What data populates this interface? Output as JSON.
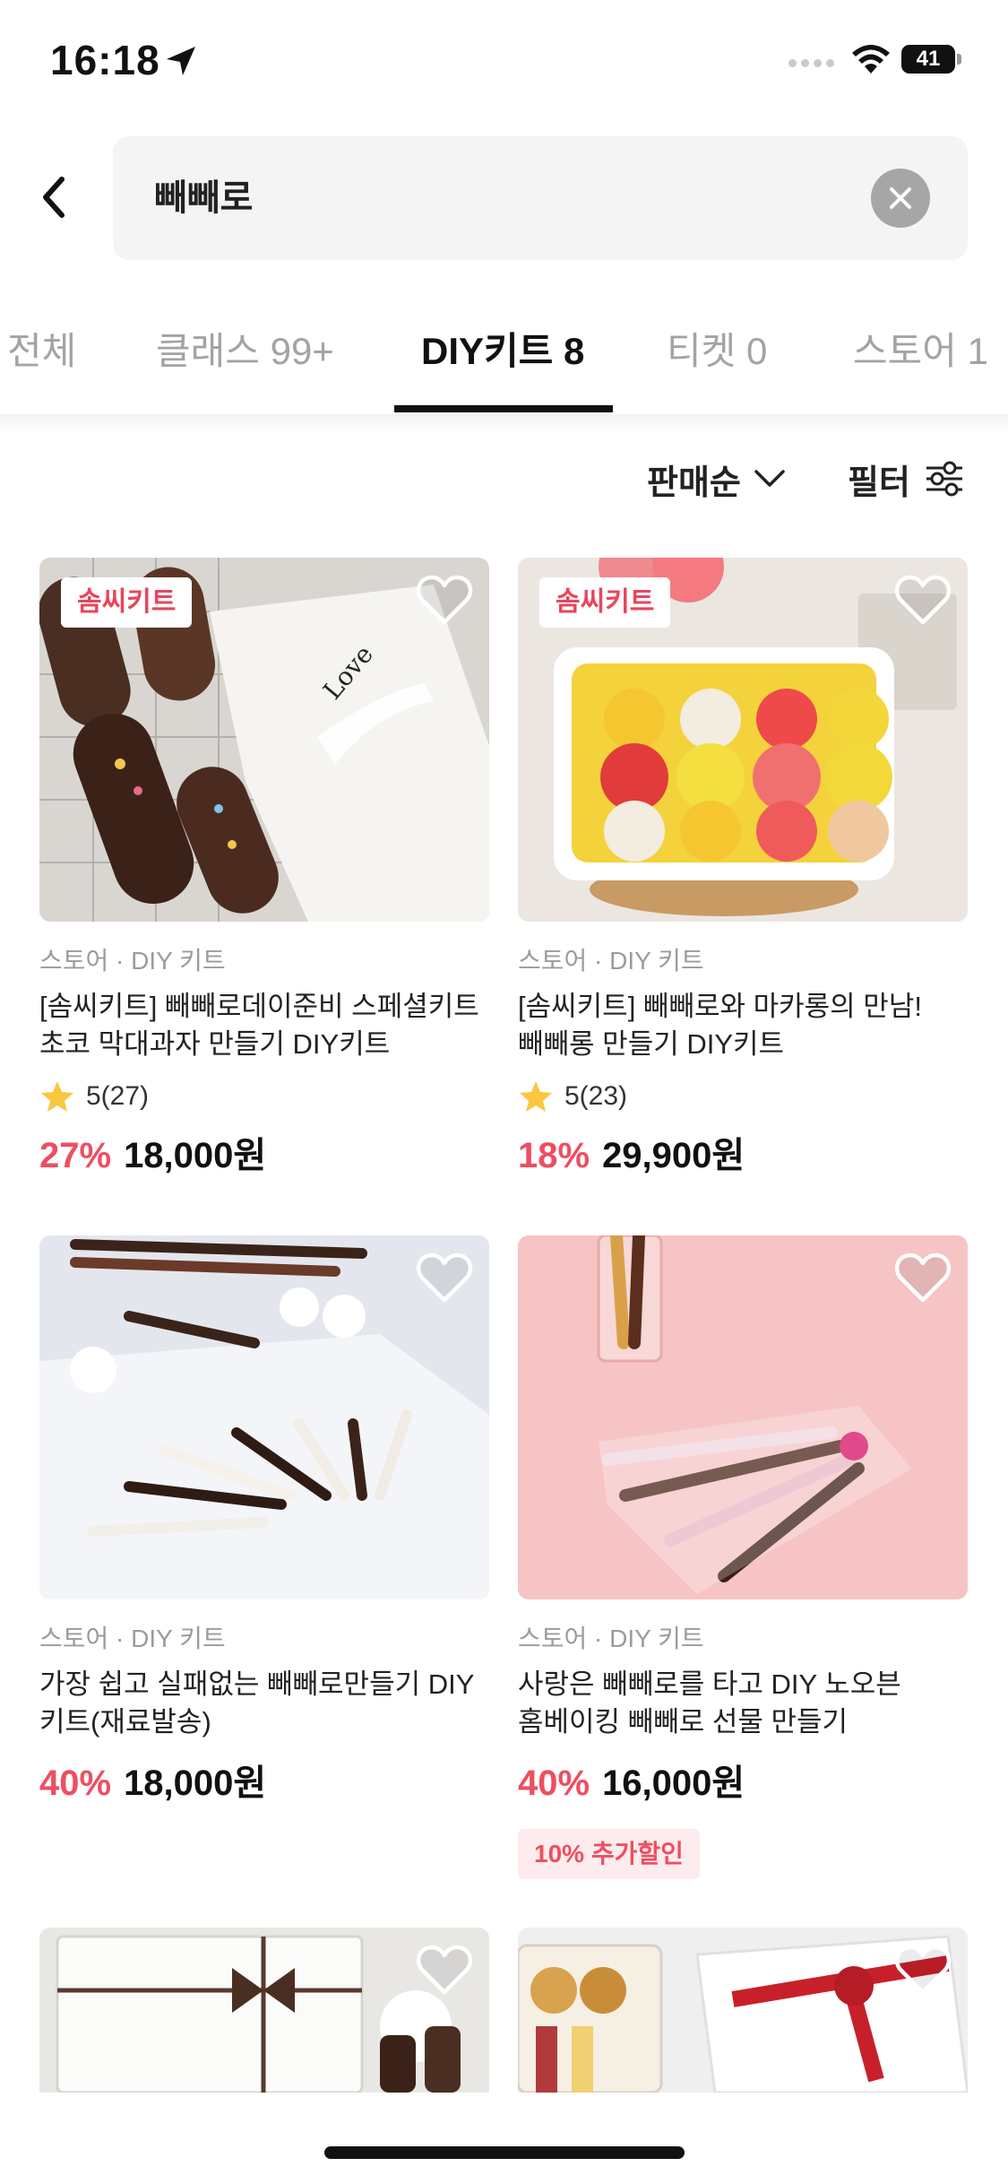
{
  "status_bar": {
    "time": "16:18",
    "battery": "41"
  },
  "search": {
    "query": "빼빼로"
  },
  "tabs": [
    {
      "label": "전체"
    },
    {
      "label": "클래스 99+"
    },
    {
      "label": "DIY키트 8"
    },
    {
      "label": "티켓 0"
    },
    {
      "label": "스토어 1"
    }
  ],
  "active_tab": "DIY키트 8",
  "sort": {
    "label": "판매순"
  },
  "filter": {
    "label": "필터"
  },
  "products": [
    {
      "badge": "솜씨키트",
      "category": "스토어 · DIY 키트",
      "title_line1": "[솜씨키트] 빼빼로데이준비 스페셜키트",
      "title_line2": "초코 막대과자 만들기 DIY키트",
      "rating": "5(27)",
      "discount": "27%",
      "price": "18,000원"
    },
    {
      "badge": "솜씨키트",
      "category": "스토어 · DIY 키트",
      "title_line1": "[솜씨키트] 빼빼로와 마카롱의 만남!",
      "title_line2": "빼빼롱 만들기 DIY키트",
      "rating": "5(23)",
      "discount": "18%",
      "price": "29,900원"
    },
    {
      "category": "스토어 · DIY 키트",
      "title_line1": "가장 쉽고 실패없는 빼빼로만들기 DIY",
      "title_line2": "키트(재료발송)",
      "discount": "40%",
      "price": "18,000원"
    },
    {
      "category": "스토어 · DIY 키트",
      "title_line1": "사랑은 빼빼로를 타고 DIY 노오븐",
      "title_line2": "홈베이킹 빼빼로 선물 만들기",
      "discount": "40%",
      "price": "16,000원",
      "extra_badge": "10% 추가할인"
    }
  ],
  "colors": {
    "accent": "#ee4e61",
    "badge_text": "#e8465b",
    "inactive_tab": "#a3a3a3",
    "search_bg": "#f4f4f5",
    "extra_badge_bg": "#fdecee"
  },
  "icons": [
    "location-arrow-icon",
    "wifi-icon",
    "back-arrow-icon",
    "clear-icon",
    "chevron-down-icon",
    "filter-sliders-icon",
    "heart-icon",
    "star-icon"
  ]
}
